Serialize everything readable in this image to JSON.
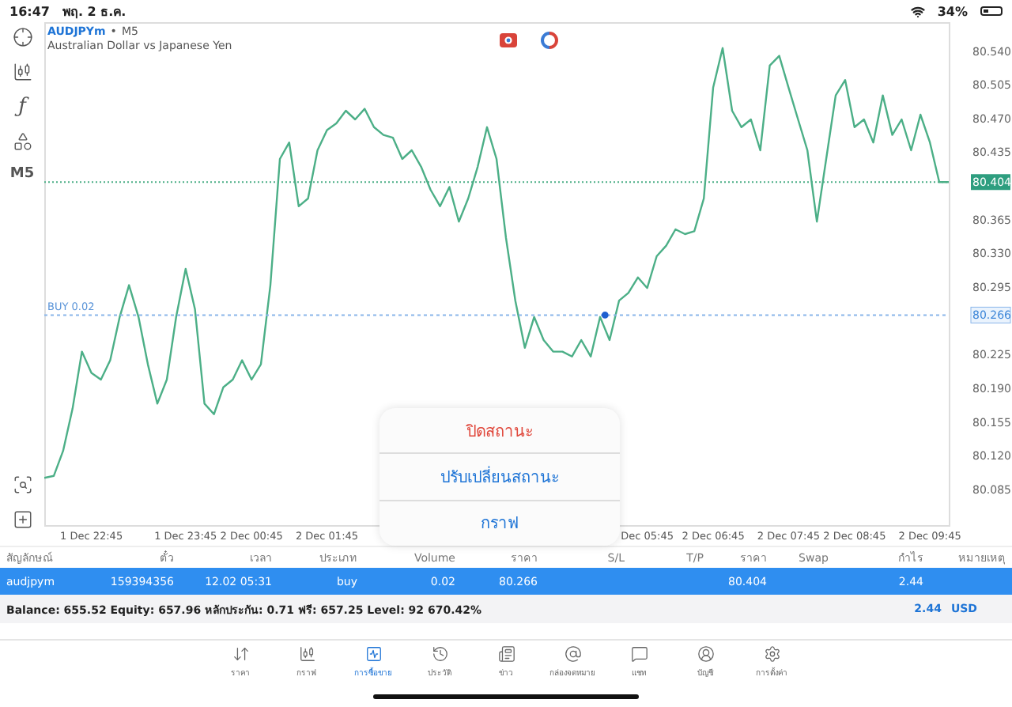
{
  "status_bar": {
    "time": "16:47",
    "date": "พฤ. 2 ธ.ค.",
    "battery": "34%"
  },
  "left_toolbar": {
    "indicator_glyph": "ƒ",
    "timeframe": "M5"
  },
  "chart_header": {
    "symbol": "AUDJPYm",
    "separator": "•",
    "timeframe": "M5",
    "description": "Australian Dollar vs Japanese Yen"
  },
  "chart": {
    "price_line": {
      "price": "80.404"
    },
    "position_line": {
      "label": "BUY 0.02",
      "price": "80.266"
    },
    "chart_data": {
      "type": "line",
      "categories": [
        null,
        null,
        null,
        null,
        null,
        "1 Dec 22:45",
        null,
        null,
        null,
        null,
        null,
        null,
        null,
        null,
        null,
        "1 Dec 23:45",
        null,
        null,
        null,
        null,
        null,
        null,
        "2 Dec 00:45",
        null,
        null,
        null,
        null,
        null,
        null,
        null,
        "2 Dec 01:45",
        null,
        null,
        null,
        null,
        null,
        null,
        null,
        null,
        null,
        null,
        null,
        null,
        null,
        null,
        null,
        null,
        null,
        null,
        null,
        null,
        null,
        null,
        null,
        null,
        null,
        null,
        null,
        null,
        null,
        null,
        null,
        null,
        null,
        "Dec 05:45",
        null,
        null,
        null,
        null,
        null,
        null,
        "2 Dec 06:45",
        null,
        null,
        null,
        null,
        null,
        null,
        null,
        "2 Dec 07:45",
        null,
        null,
        null,
        null,
        null,
        null,
        "2 Dec 08:45",
        null,
        null,
        null,
        null,
        null,
        null,
        null,
        "2 Dec 09:45",
        null,
        null
      ],
      "series": [
        {
          "color": "#4caf87",
          "values": [
            80.097,
            80.099,
            80.125,
            80.169,
            80.228,
            80.206,
            80.199,
            80.219,
            80.264,
            80.297,
            80.264,
            80.215,
            80.174,
            80.199,
            80.264,
            80.314,
            80.272,
            80.174,
            80.163,
            80.191,
            80.199,
            80.219,
            80.199,
            80.215,
            80.297,
            80.428,
            80.445,
            80.379,
            80.387,
            80.437,
            80.458,
            80.465,
            80.478,
            80.469,
            80.48,
            80.461,
            80.453,
            80.45,
            80.428,
            80.437,
            80.42,
            80.396,
            80.379,
            80.399,
            80.363,
            80.387,
            80.42,
            80.461,
            80.428,
            80.346,
            80.281,
            80.232,
            80.264,
            80.24,
            80.228,
            80.228,
            80.223,
            80.24,
            80.223,
            80.264,
            80.24,
            80.281,
            80.289,
            80.305,
            80.294,
            80.327,
            80.338,
            80.355,
            80.35,
            80.353,
            80.387,
            80.502,
            80.543,
            80.478,
            80.461,
            80.469,
            80.437,
            80.525,
            80.535,
            80.502,
            80.469,
            80.437,
            80.363,
            80.428,
            80.494,
            80.51,
            80.461,
            80.469,
            80.445,
            80.494,
            80.453,
            80.469,
            80.437,
            80.474,
            80.445,
            80.404,
            80.404
          ]
        }
      ],
      "ylim": [
        80.048,
        80.57
      ],
      "yticks": [
        {
          "value": 80.54,
          "label": "80.540"
        },
        {
          "value": 80.505,
          "label": "80.505"
        },
        {
          "value": 80.47,
          "label": "80.470"
        },
        {
          "value": 80.435,
          "label": "80.435"
        },
        {
          "value": 80.365,
          "label": "80.365"
        },
        {
          "value": 80.33,
          "label": "80.330"
        },
        {
          "value": 80.295,
          "label": "80.295"
        },
        {
          "value": 80.225,
          "label": "80.225"
        },
        {
          "value": 80.19,
          "label": "80.190"
        },
        {
          "value": 80.155,
          "label": "80.155"
        },
        {
          "value": 80.12,
          "label": "80.120"
        },
        {
          "value": 80.085,
          "label": "80.085"
        }
      ],
      "ref_lines": [
        {
          "axis": "y",
          "value": 80.404,
          "color": "#4caf87"
        },
        {
          "axis": "y",
          "value": 80.266,
          "color": "#8ab6ea"
        }
      ]
    }
  },
  "popup_menu": [
    {
      "label": "ปิดสถานะ",
      "kind": "destructive"
    },
    {
      "label": "ปรับเปลี่ยนสถานะ",
      "kind": "normal"
    },
    {
      "label": "กราฟ",
      "kind": "normal"
    }
  ],
  "table": {
    "columns": [
      "สัญลักษณ์",
      "ตั๋ว",
      "เวลา",
      "ประเภท",
      "Volume",
      "ราคา",
      "S/L",
      "T/P",
      "ราคา",
      "Swap",
      "กำไร",
      "หมายเหตุ"
    ],
    "rows": [
      {
        "selected": true,
        "cells": [
          "audjpym",
          "159394356",
          "12.02 05:31",
          "buy",
          "0.02",
          "80.266",
          "",
          "",
          "80.404",
          "",
          "2.44",
          ""
        ]
      }
    ]
  },
  "summary": {
    "text": "Balance: 655.52 Equity: 657.96 หลักประกัน: 0.71 ฟรี: 657.25 Level: 92 670.42%",
    "profit": "2.44",
    "currency": "USD"
  },
  "tab_bar": [
    {
      "label": "ราคา",
      "selected": false
    },
    {
      "label": "กราฟ",
      "selected": false
    },
    {
      "label": "การซื้อขาย",
      "selected": true
    },
    {
      "label": "ประวัติ",
      "selected": false
    },
    {
      "label": "ข่าว",
      "selected": false
    },
    {
      "label": "กล่องจดหมาย",
      "selected": false
    },
    {
      "label": "แชท",
      "selected": false
    },
    {
      "label": "บัญชี",
      "selected": false
    },
    {
      "label": "การตั้งค่า",
      "selected": false
    }
  ]
}
